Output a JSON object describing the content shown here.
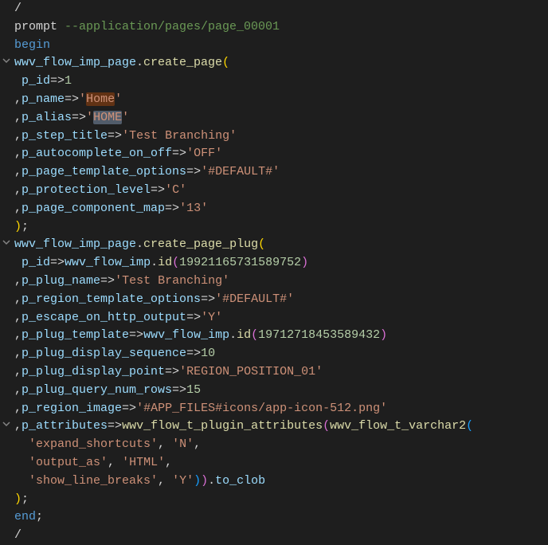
{
  "code": {
    "slash1": "/",
    "prompt_kw": "prompt",
    "prompt_arg": " --application/pages/page_00001",
    "begin_kw": "begin",
    "cp": {
      "obj": "wwv_flow_imp_page",
      "fn": "create_page",
      "p_id_k": "p_id",
      "p_id_v": "1",
      "p_name_k": "p_name",
      "p_name_v": "'Home'",
      "p_alias_k": "p_alias",
      "p_alias_v": "'HOME'",
      "p_step_title_k": "p_step_title",
      "p_step_title_v": "'Test Branching'",
      "p_auto_k": "p_autocomplete_on_off",
      "p_auto_v": "'OFF'",
      "p_tmpl_k": "p_page_template_options",
      "p_tmpl_v": "'#DEFAULT#'",
      "p_prot_k": "p_protection_level",
      "p_prot_v": "'C'",
      "p_comp_k": "p_page_component_map",
      "p_comp_v": "'13'"
    },
    "cpp": {
      "obj": "wwv_flow_imp_page",
      "fn": "create_page_plug",
      "p_id_k": "p_id",
      "p_id_obj": "wwv_flow_imp",
      "p_id_fn": "id",
      "p_id_num": "19921165731589752",
      "p_plug_name_k": "p_plug_name",
      "p_plug_name_v": "'Test Branching'",
      "p_rtmpl_k": "p_region_template_options",
      "p_rtmpl_v": "'#DEFAULT#'",
      "p_escape_k": "p_escape_on_http_output",
      "p_escape_v": "'Y'",
      "p_ptmpl_k": "p_plug_template",
      "p_ptmpl_obj": "wwv_flow_imp",
      "p_ptmpl_fn": "id",
      "p_ptmpl_num": "19712718453589432",
      "p_seq_k": "p_plug_display_sequence",
      "p_seq_v": "10",
      "p_point_k": "p_plug_display_point",
      "p_point_v": "'REGION_POSITION_01'",
      "p_rows_k": "p_plug_query_num_rows",
      "p_rows_v": "15",
      "p_img_k": "p_region_image",
      "p_img_v": "'#APP_FILES#icons/app-icon-512.png'",
      "p_attr_k": "p_attributes",
      "p_attr_fn": "wwv_flow_t_plugin_attributes",
      "p_attr_inner_fn": "wwv_flow_t_varchar2",
      "attr1_k": "'expand_shortcuts'",
      "attr1_v": "'N'",
      "attr2_k": "'output_as'",
      "attr2_v": "'HTML'",
      "attr3_k": "'show_line_breaks'",
      "attr3_v": "'Y'",
      "to_clob": "to_clob"
    },
    "end_kw": "end",
    "slash2": "/",
    "arrow": "=>",
    "semicolon": ";",
    "comma": ",",
    "dot": ".",
    "lparen": "(",
    "rparen": ")"
  }
}
